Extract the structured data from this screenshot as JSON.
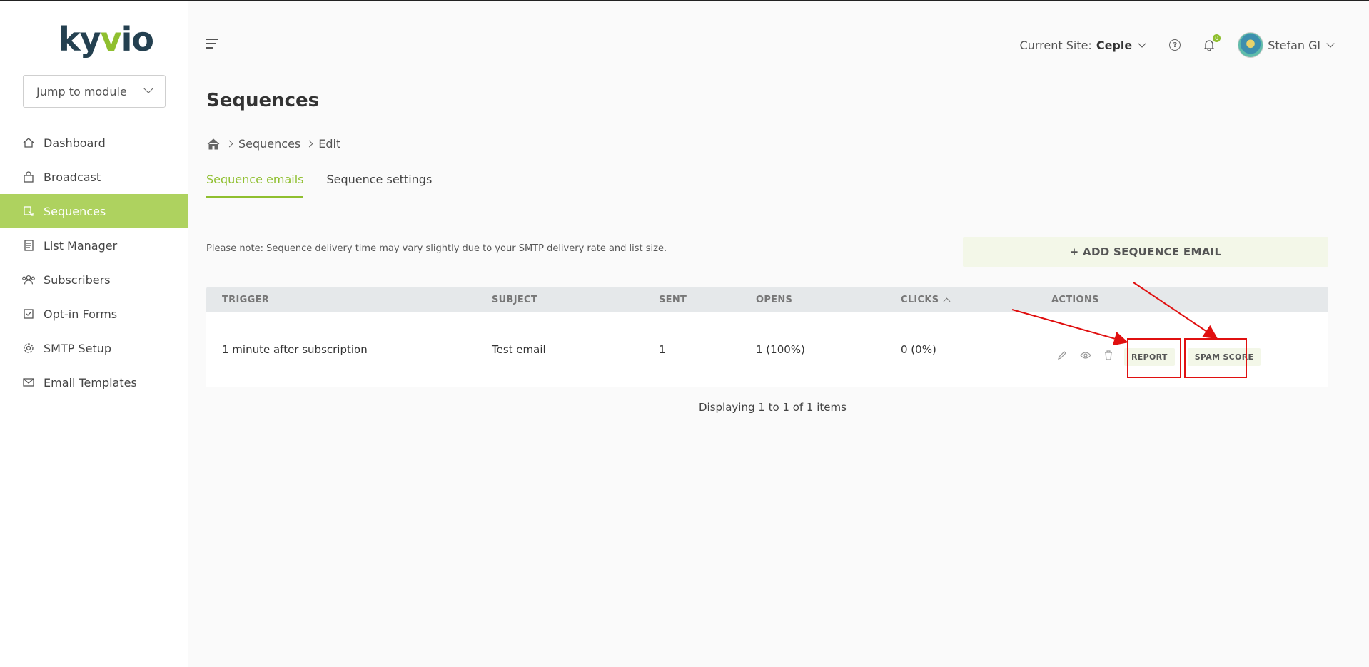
{
  "brand": {
    "logo_text_a": "ky",
    "logo_text_b": "v",
    "logo_text_c": "io",
    "accent": "#8fbf2f",
    "active_nav_bg": "#aed25f"
  },
  "sidebar": {
    "jump_placeholder": "Jump to module",
    "items": [
      {
        "label": "Dashboard",
        "icon": "home-icon"
      },
      {
        "label": "Broadcast",
        "icon": "bag-icon"
      },
      {
        "label": "Sequences",
        "icon": "sequences-icon",
        "active": true
      },
      {
        "label": "List Manager",
        "icon": "list-icon"
      },
      {
        "label": "Subscribers",
        "icon": "users-icon"
      },
      {
        "label": "Opt-in Forms",
        "icon": "checkbox-icon"
      },
      {
        "label": "SMTP Setup",
        "icon": "gear-icon"
      },
      {
        "label": "Email Templates",
        "icon": "envelope-icon"
      }
    ]
  },
  "header": {
    "site_label": "Current Site:",
    "site_name": "Ceple",
    "notification_count": "0",
    "user_name": "Stefan Gl"
  },
  "page": {
    "title": "Sequences",
    "breadcrumb": [
      "Sequences",
      "Edit"
    ],
    "tabs": [
      {
        "label": "Sequence emails",
        "active": true
      },
      {
        "label": "Sequence settings"
      }
    ],
    "note": "Please note: Sequence delivery time may vary slightly due to your SMTP delivery rate and list size.",
    "add_button": "+ ADD SEQUENCE EMAIL"
  },
  "table": {
    "headers": [
      "TRIGGER",
      "SUBJECT",
      "SENT",
      "OPENS",
      "CLICKS",
      "ACTIONS"
    ],
    "rows": [
      {
        "trigger": "1 minute after subscription",
        "subject": "Test email",
        "sent": "1",
        "opens": "1 (100%)",
        "clicks": "0 (0%)"
      }
    ],
    "actions": {
      "report": "REPORT",
      "spam_score": "SPAM SCORE"
    },
    "footer": "Displaying 1 to 1 of 1 items"
  }
}
